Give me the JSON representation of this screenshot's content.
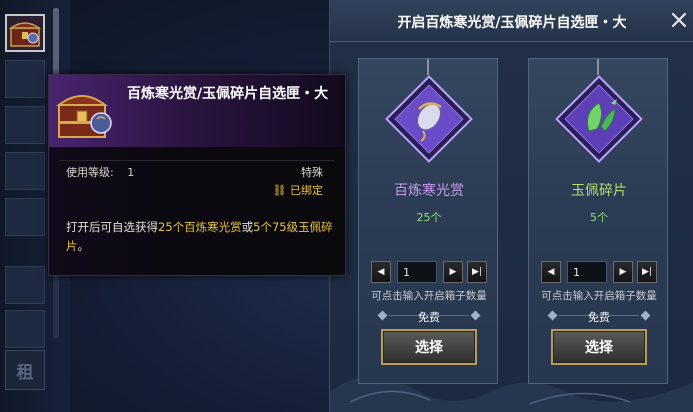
{
  "inventory": {
    "lock_label": "租"
  },
  "tooltip": {
    "title": "百炼寒光赏/玉佩碎片自选匣・大",
    "level_label": "使用等级:",
    "level_value": "1",
    "rarity": "特殊",
    "bound_label": "已绑定",
    "desc_prefix": "打开后可自选获得",
    "desc_highlight_1": "25个百炼寒光赏",
    "desc_mid": "或",
    "desc_highlight_2": "5个75级玉佩碎片",
    "desc_suffix": "。"
  },
  "panel": {
    "title": "开启百炼寒光赏/玉佩碎片自选匣・大",
    "close_icon": "close-icon"
  },
  "cards": [
    {
      "name": "百炼寒光赏",
      "count": "25个",
      "quantity": "1",
      "hint": "可点击输入开启箱子数量",
      "cost": "免费",
      "button": "选择",
      "gem_color": "#6a4cc8",
      "name_color": "#c79bec"
    },
    {
      "name": "玉佩碎片",
      "count": "5个",
      "quantity": "1",
      "hint": "可点击输入开启箱子数量",
      "cost": "免费",
      "button": "选择",
      "gem_color": "#5f3fb8",
      "name_color": "#b6de6e"
    }
  ],
  "colors": {
    "gold_text": "#e8c53a",
    "count_green": "#8be06f",
    "button_border": "#b99a56"
  }
}
